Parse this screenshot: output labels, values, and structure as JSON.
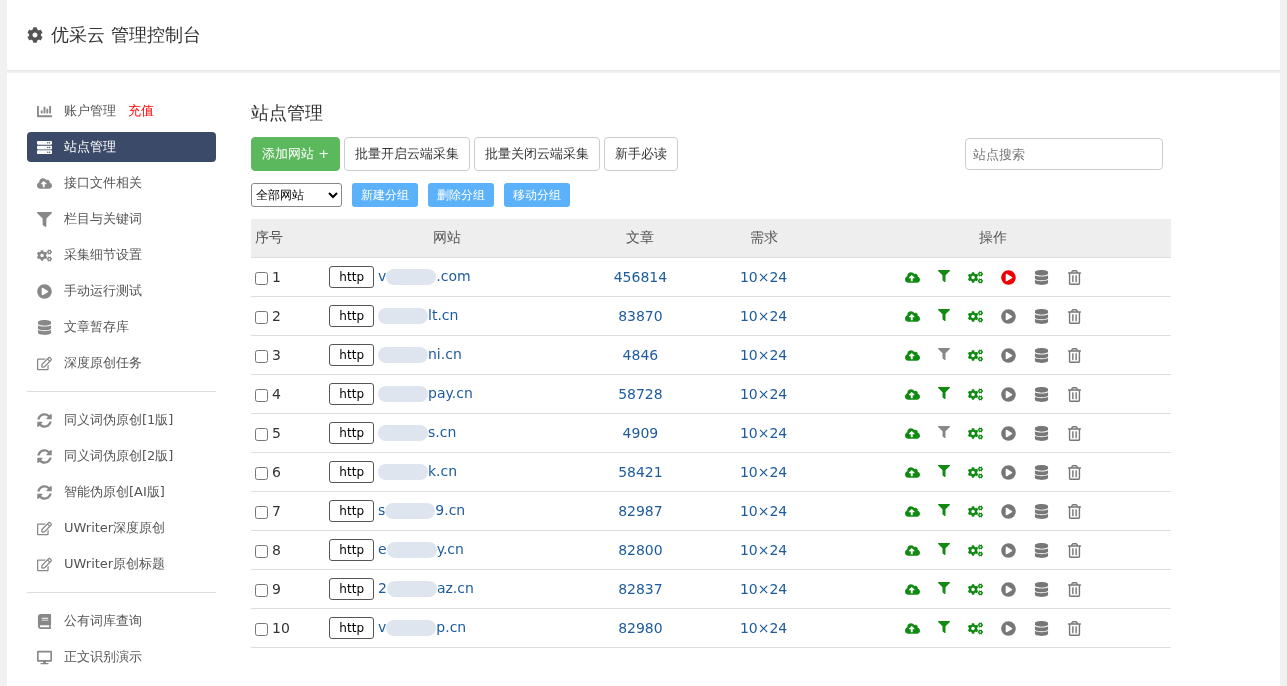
{
  "header": {
    "title": "优采云 管理控制台"
  },
  "sidebar": {
    "groups": [
      {
        "items": [
          {
            "label": "账户管理",
            "extra": "充值",
            "selected": false
          },
          {
            "label": "站点管理",
            "selected": true
          },
          {
            "label": "接口文件相关",
            "selected": false
          },
          {
            "label": "栏目与关键词",
            "selected": false
          },
          {
            "label": "采集细节设置",
            "selected": false
          },
          {
            "label": "手动运行测试",
            "selected": false
          },
          {
            "label": "文章暂存库",
            "selected": false
          },
          {
            "label": "深度原创任务",
            "selected": false
          }
        ]
      },
      {
        "items": [
          {
            "label": "同义词伪原创[1版]",
            "selected": false
          },
          {
            "label": "同义词伪原创[2版]",
            "selected": false
          },
          {
            "label": "智能伪原创[AI版]",
            "selected": false
          },
          {
            "label": "UWriter深度原创",
            "selected": false
          },
          {
            "label": "UWriter原创标题",
            "selected": false
          }
        ]
      },
      {
        "items": [
          {
            "label": "公有词库查询",
            "selected": false
          },
          {
            "label": "正文识别演示",
            "selected": false
          }
        ]
      }
    ]
  },
  "main": {
    "title": "站点管理",
    "toolbar": {
      "primary": "添加网站 +",
      "buttons": [
        "批量开启云端采集",
        "批量关闭云端采集",
        "新手必读"
      ],
      "search": {
        "placeholder": "站点搜索"
      }
    },
    "groupbar": {
      "select": "全部网站",
      "buttons": [
        "新建分组",
        "删除分组",
        "移动分组"
      ]
    },
    "table": {
      "columns": [
        "序号",
        "网站",
        "文章",
        "需求",
        "操作"
      ],
      "rows": [
        {
          "no": "1",
          "proto": "http",
          "site_start": "v",
          "site_end": ".com",
          "articles": "456814",
          "demand": "10×24",
          "filter_on": true,
          "running": true,
          "checked": false
        },
        {
          "no": "2",
          "proto": "http",
          "site_start": "",
          "site_end": "lt.cn",
          "articles": "83870",
          "demand": "10×24",
          "filter_on": true,
          "running": false,
          "checked": false
        },
        {
          "no": "3",
          "proto": "http",
          "site_start": "",
          "site_end": "ni.cn",
          "articles": "4846",
          "demand": "10×24",
          "filter_on": false,
          "running": false,
          "checked": false
        },
        {
          "no": "4",
          "proto": "http",
          "site_start": "",
          "site_end": "pay.cn",
          "articles": "58728",
          "demand": "10×24",
          "filter_on": true,
          "running": false,
          "checked": false
        },
        {
          "no": "5",
          "proto": "http",
          "site_start": "",
          "site_end": "s.cn",
          "articles": "4909",
          "demand": "10×24",
          "filter_on": false,
          "running": false,
          "checked": false
        },
        {
          "no": "6",
          "proto": "http",
          "site_start": "",
          "site_end": "k.cn",
          "articles": "58421",
          "demand": "10×24",
          "filter_on": true,
          "running": false,
          "checked": false
        },
        {
          "no": "7",
          "proto": "http",
          "site_start": "s",
          "site_end": "9.cn",
          "articles": "82987",
          "demand": "10×24",
          "filter_on": true,
          "running": false,
          "checked": false
        },
        {
          "no": "8",
          "proto": "http",
          "site_start": "e",
          "site_end": "y.cn",
          "articles": "82800",
          "demand": "10×24",
          "filter_on": true,
          "running": false,
          "checked": false
        },
        {
          "no": "9",
          "proto": "http",
          "site_start": "2",
          "site_end": "az.cn",
          "articles": "82837",
          "demand": "10×24",
          "filter_on": true,
          "running": false,
          "checked": false
        },
        {
          "no": "10",
          "proto": "http",
          "site_start": "v",
          "site_end": "p.cn",
          "articles": "82980",
          "demand": "10×24",
          "filter_on": true,
          "running": false,
          "checked": false
        }
      ]
    }
  }
}
